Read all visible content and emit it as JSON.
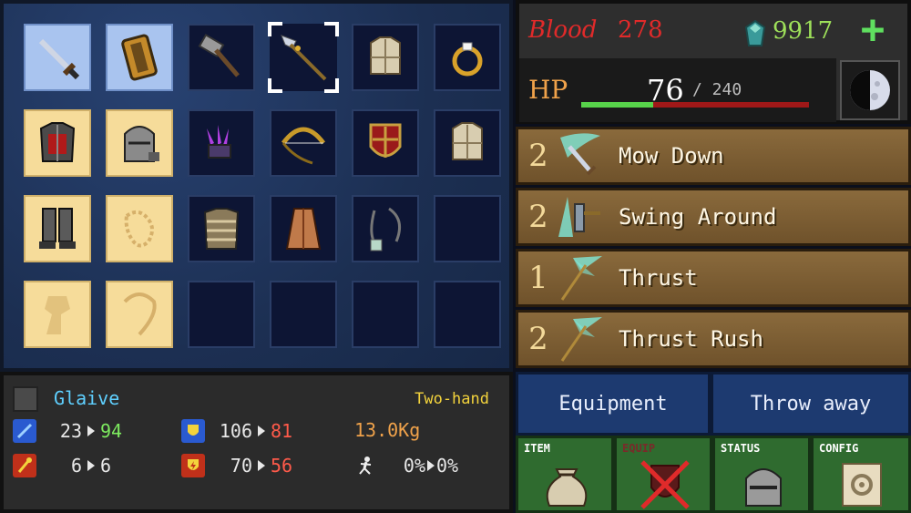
{
  "inventory": {
    "slots": [
      {
        "item": "sword",
        "state": "equipped"
      },
      {
        "item": "shield",
        "state": "equipped"
      },
      {
        "item": "hammer",
        "state": "normal"
      },
      {
        "item": "glaive",
        "state": "selected"
      },
      {
        "item": "cloth-armor",
        "state": "normal"
      },
      {
        "item": "ring",
        "state": "normal"
      },
      {
        "item": "red-armor",
        "state": "empty-equip"
      },
      {
        "item": "helmet",
        "state": "empty-equip"
      },
      {
        "item": "claw",
        "state": "normal"
      },
      {
        "item": "bow",
        "state": "normal"
      },
      {
        "item": "red-shield",
        "state": "normal"
      },
      {
        "item": "cloth-armor-2",
        "state": "normal"
      },
      {
        "item": "greaves",
        "state": "empty-equip"
      },
      {
        "item": "gauntlet-outline",
        "state": "empty-equip"
      },
      {
        "item": "scale-armor",
        "state": "normal"
      },
      {
        "item": "robe",
        "state": "normal"
      },
      {
        "item": "amulet",
        "state": "normal"
      },
      {
        "item": "",
        "state": "normal"
      },
      {
        "item": "cape-outline",
        "state": "empty-equip"
      },
      {
        "item": "necklace-outline",
        "state": "empty-equip"
      },
      {
        "item": "",
        "state": "normal"
      },
      {
        "item": "",
        "state": "normal"
      },
      {
        "item": "",
        "state": "normal"
      },
      {
        "item": "",
        "state": "normal"
      }
    ]
  },
  "selected_item": {
    "name": "Glaive",
    "hand": "Two-hand",
    "attack_before": "23",
    "attack_after": "94",
    "magic_before": "6",
    "magic_after": "6",
    "defense_before": "106",
    "defense_after": "81",
    "magic_def_before": "70",
    "magic_def_after": "56",
    "weight": "13.0Kg",
    "dodge_before": "0%",
    "dodge_after": "0%"
  },
  "header": {
    "blood_label": "Blood",
    "blood_value": "278",
    "gem_value": "9917",
    "plus_label": "+",
    "hp_label": "HP",
    "hp_current": "76",
    "hp_max": "/ 240",
    "hp_fraction": 0.3167
  },
  "skills": [
    {
      "level": "2",
      "name": "Mow Down"
    },
    {
      "level": "2",
      "name": "Swing Around"
    },
    {
      "level": "1",
      "name": "Thrust"
    },
    {
      "level": "2",
      "name": "Thrust Rush"
    }
  ],
  "actions": {
    "equipment": "Equipment",
    "throw_away": "Throw away"
  },
  "tabs": {
    "item": "ITEM",
    "equip": "EQUIP",
    "status": "STATUS",
    "config": "CONFIG"
  },
  "colors": {
    "blood": "#e02a2a",
    "gem": "#9ee05a",
    "hp_label": "#f0a24a",
    "stat_up": "#7dea5f",
    "stat_down": "#ff5a4a",
    "item_name": "#5fd0ff",
    "hand": "#f3d33c"
  }
}
